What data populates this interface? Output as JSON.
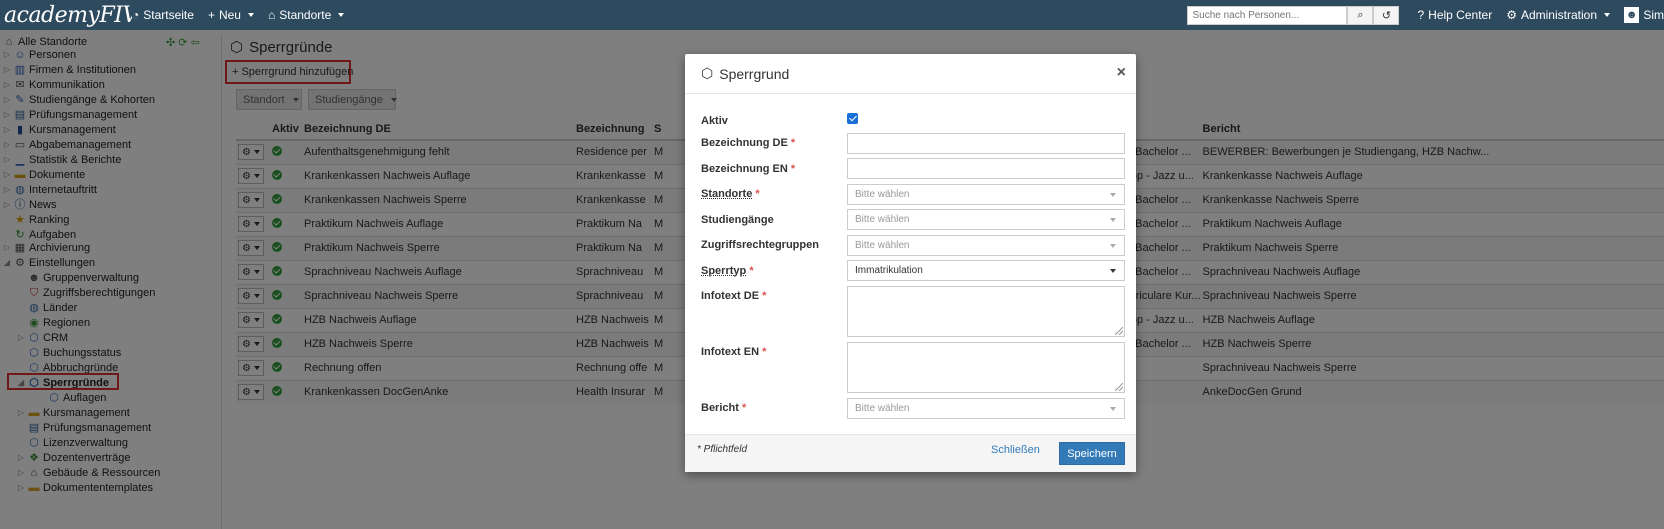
{
  "navbar": {
    "brand": "academyFIVE",
    "items": [
      {
        "label": "Startseite",
        "icon": "dashboard-icon",
        "caret": false
      },
      {
        "label": "Neu",
        "icon": "plus-icon",
        "caret": true
      },
      {
        "label": "Standorte",
        "icon": "home-icon",
        "caret": true
      }
    ],
    "search_placeholder": "Suche nach Personen...",
    "help": "Help Center",
    "admin": "Administration",
    "user": "Sim"
  },
  "sidebar": {
    "items": [
      {
        "label": "Alle Standorte",
        "icon": "building-icon",
        "level": 0,
        "arrow": ""
      },
      {
        "label": "Personen",
        "icon": "people-icon",
        "level": 0,
        "arrow": "right"
      },
      {
        "label": "Firmen & Institutionen",
        "icon": "factory-icon",
        "level": 0,
        "arrow": "right"
      },
      {
        "label": "Kommunikation",
        "icon": "envelope-icon",
        "level": 0,
        "arrow": "right"
      },
      {
        "label": "Studiengänge & Kohorten",
        "icon": "pen-icon",
        "level": 0,
        "arrow": "right"
      },
      {
        "label": "Prüfungsmanagement",
        "icon": "exam-icon",
        "level": 0,
        "arrow": "right"
      },
      {
        "label": "Kursmanagement",
        "icon": "book-icon",
        "level": 0,
        "arrow": "right"
      },
      {
        "label": "Abgabemanagement",
        "icon": "card-icon",
        "level": 0,
        "arrow": "right"
      },
      {
        "label": "Statistik & Berichte",
        "icon": "bar-chart-icon",
        "level": 0,
        "arrow": "right"
      },
      {
        "label": "Dokumente",
        "icon": "folder-icon",
        "level": 0,
        "arrow": "right"
      },
      {
        "label": "Internetauftritt",
        "icon": "globe-icon",
        "level": 0,
        "arrow": "right"
      },
      {
        "label": "News",
        "icon": "info-icon",
        "level": 0,
        "arrow": "right"
      },
      {
        "label": "Ranking",
        "icon": "star-icon",
        "level": 0,
        "arrow": ""
      },
      {
        "label": "Aufgaben",
        "icon": "refresh-icon",
        "level": 0,
        "arrow": ""
      },
      {
        "label": "Archivierung",
        "icon": "archive-icon",
        "level": 0,
        "arrow": "right"
      },
      {
        "label": "Einstellungen",
        "icon": "gear-icon",
        "level": 0,
        "arrow": "down"
      },
      {
        "label": "Gruppenverwaltung",
        "icon": "user-icon",
        "level": 1,
        "arrow": ""
      },
      {
        "label": "Zugriffsberechtigungen",
        "icon": "shield-icon",
        "level": 1,
        "arrow": ""
      },
      {
        "label": "Länder",
        "icon": "globe-icon",
        "level": 1,
        "arrow": ""
      },
      {
        "label": "Regionen",
        "icon": "map-icon",
        "level": 1,
        "arrow": ""
      },
      {
        "label": "CRM",
        "icon": "tag-icon",
        "level": 1,
        "arrow": "right"
      },
      {
        "label": "Buchungsstatus",
        "icon": "tag-icon",
        "level": 1,
        "arrow": ""
      },
      {
        "label": "Abbruchgründe",
        "icon": "tag-icon",
        "level": 1,
        "arrow": ""
      },
      {
        "label": "Sperrgründe",
        "icon": "tag-icon",
        "level": 1,
        "arrow": "down",
        "selected": true
      },
      {
        "label": "Auflagen",
        "icon": "tag-icon",
        "level": 2,
        "arrow": ""
      },
      {
        "label": "Kursmanagement",
        "icon": "folder-icon",
        "level": 1,
        "arrow": "right"
      },
      {
        "label": "Prüfungsmanagement",
        "icon": "exam-icon",
        "level": 1,
        "arrow": ""
      },
      {
        "label": "Lizenzverwaltung",
        "icon": "tag-icon",
        "level": 1,
        "arrow": ""
      },
      {
        "label": "Dozentenverträge",
        "icon": "contract-icon",
        "level": 1,
        "arrow": "right"
      },
      {
        "label": "Gebäude & Ressourcen",
        "icon": "house-icon",
        "level": 1,
        "arrow": "right"
      },
      {
        "label": "Dokumententemplates",
        "icon": "folder-icon",
        "level": 1,
        "arrow": "right"
      }
    ]
  },
  "page": {
    "title": "Sperrgründe",
    "add_button": "Sperrgrund hinzufügen",
    "filters": [
      "Standort",
      "Studiengänge"
    ]
  },
  "table": {
    "headers": [
      "",
      "Aktiv",
      "Bezeichnung DE",
      "Bezeichnung",
      "S",
      "",
      "Bericht"
    ],
    "rows": [
      {
        "de": "Aufenthaltsgenehmigung fehlt",
        "en": "Residence per",
        "s": "M",
        "sg": "S - Bachelor ...",
        "bericht": "BEWERBER: Bewerbungen je Studiengang, HZB Nachw..."
      },
      {
        "de": "Krankenkassen Nachweis Auflage",
        "en": "Krankenkasse",
        "s": "M",
        "sg": "zPop - Jazz u...",
        "bericht": "Krankenkasse Nachweis Auflage"
      },
      {
        "de": "Krankenkassen Nachweis Sperre",
        "en": "Krankenkasse",
        "s": "M",
        "sg": "S - Bachelor ...",
        "bericht": "Krankenkasse Nachweis Sperre"
      },
      {
        "de": "Praktikum Nachweis Auflage",
        "en": "Praktikum Na",
        "s": "M",
        "sg": "S - Bachelor ...",
        "bericht": "Praktikum Nachweis Auflage"
      },
      {
        "de": "Praktikum Nachweis Sperre",
        "en": "Praktikum Na",
        "s": "M",
        "sg": "S - Bachelor ...",
        "bericht": "Praktikum Nachweis Sperre"
      },
      {
        "de": "Sprachniveau Nachweis Auflage",
        "en": "Sprachniveau",
        "s": "M",
        "sg": "S - Bachelor ...",
        "bericht": "Sprachniveau Nachweis Auflage"
      },
      {
        "de": "Sprachniveau Nachweis Sperre",
        "en": "Sprachniveau",
        "s": "M",
        "sg": "Curriculare Kur...",
        "bericht": "Sprachniveau Nachweis Sperre"
      },
      {
        "de": "HZB Nachweis Auflage",
        "en": "HZB Nachweis",
        "s": "M",
        "sg": "zPop - Jazz u...",
        "bericht": "HZB Nachweis Auflage"
      },
      {
        "de": "HZB Nachweis Sperre",
        "en": "HZB Nachweis",
        "s": "M",
        "sg": "S - Bachelor ...",
        "bericht": "HZB Nachweis Sperre"
      },
      {
        "de": "Rechnung offen",
        "en": "Rechnung offe",
        "s": "M",
        "sg": "",
        "bericht": "Sprachniveau Nachweis Sperre"
      },
      {
        "de": "Krankenkassen DocGenAnke",
        "en": "Health Insurar",
        "s": "M",
        "sg": "",
        "bericht": "AnkeDocGen Grund"
      }
    ]
  },
  "modal": {
    "title": "Sperrgrund",
    "close_symbol": "×",
    "required_marker": "*",
    "fields": {
      "aktiv": "Aktiv",
      "bez_de": "Bezeichnung DE",
      "bez_en": "Bezeichnung EN",
      "standorte": "Standorte",
      "standorte_value": "Bitte wählen",
      "studiengaenge": "Studiengänge",
      "studiengaenge_value": "Bitte wählen",
      "zugriff": "Zugriffsrechtegruppen",
      "zugriff_value": "Bitte wählen",
      "sperrtyp": "Sperrtyp",
      "sperrtyp_value": "Immatrikulation",
      "info_de": "Infotext DE",
      "info_en": "Infotext EN",
      "bericht": "Bericht",
      "bericht_value": "Bitte wählen"
    },
    "footer_note": "* Pflichtfeld",
    "close_button": "Schließen",
    "save_button": "Speichern"
  },
  "colors": {
    "navbar": "#2e4a5e",
    "primary": "#337ab7",
    "highlight": "#e03030",
    "active": "#2e9e3e"
  }
}
